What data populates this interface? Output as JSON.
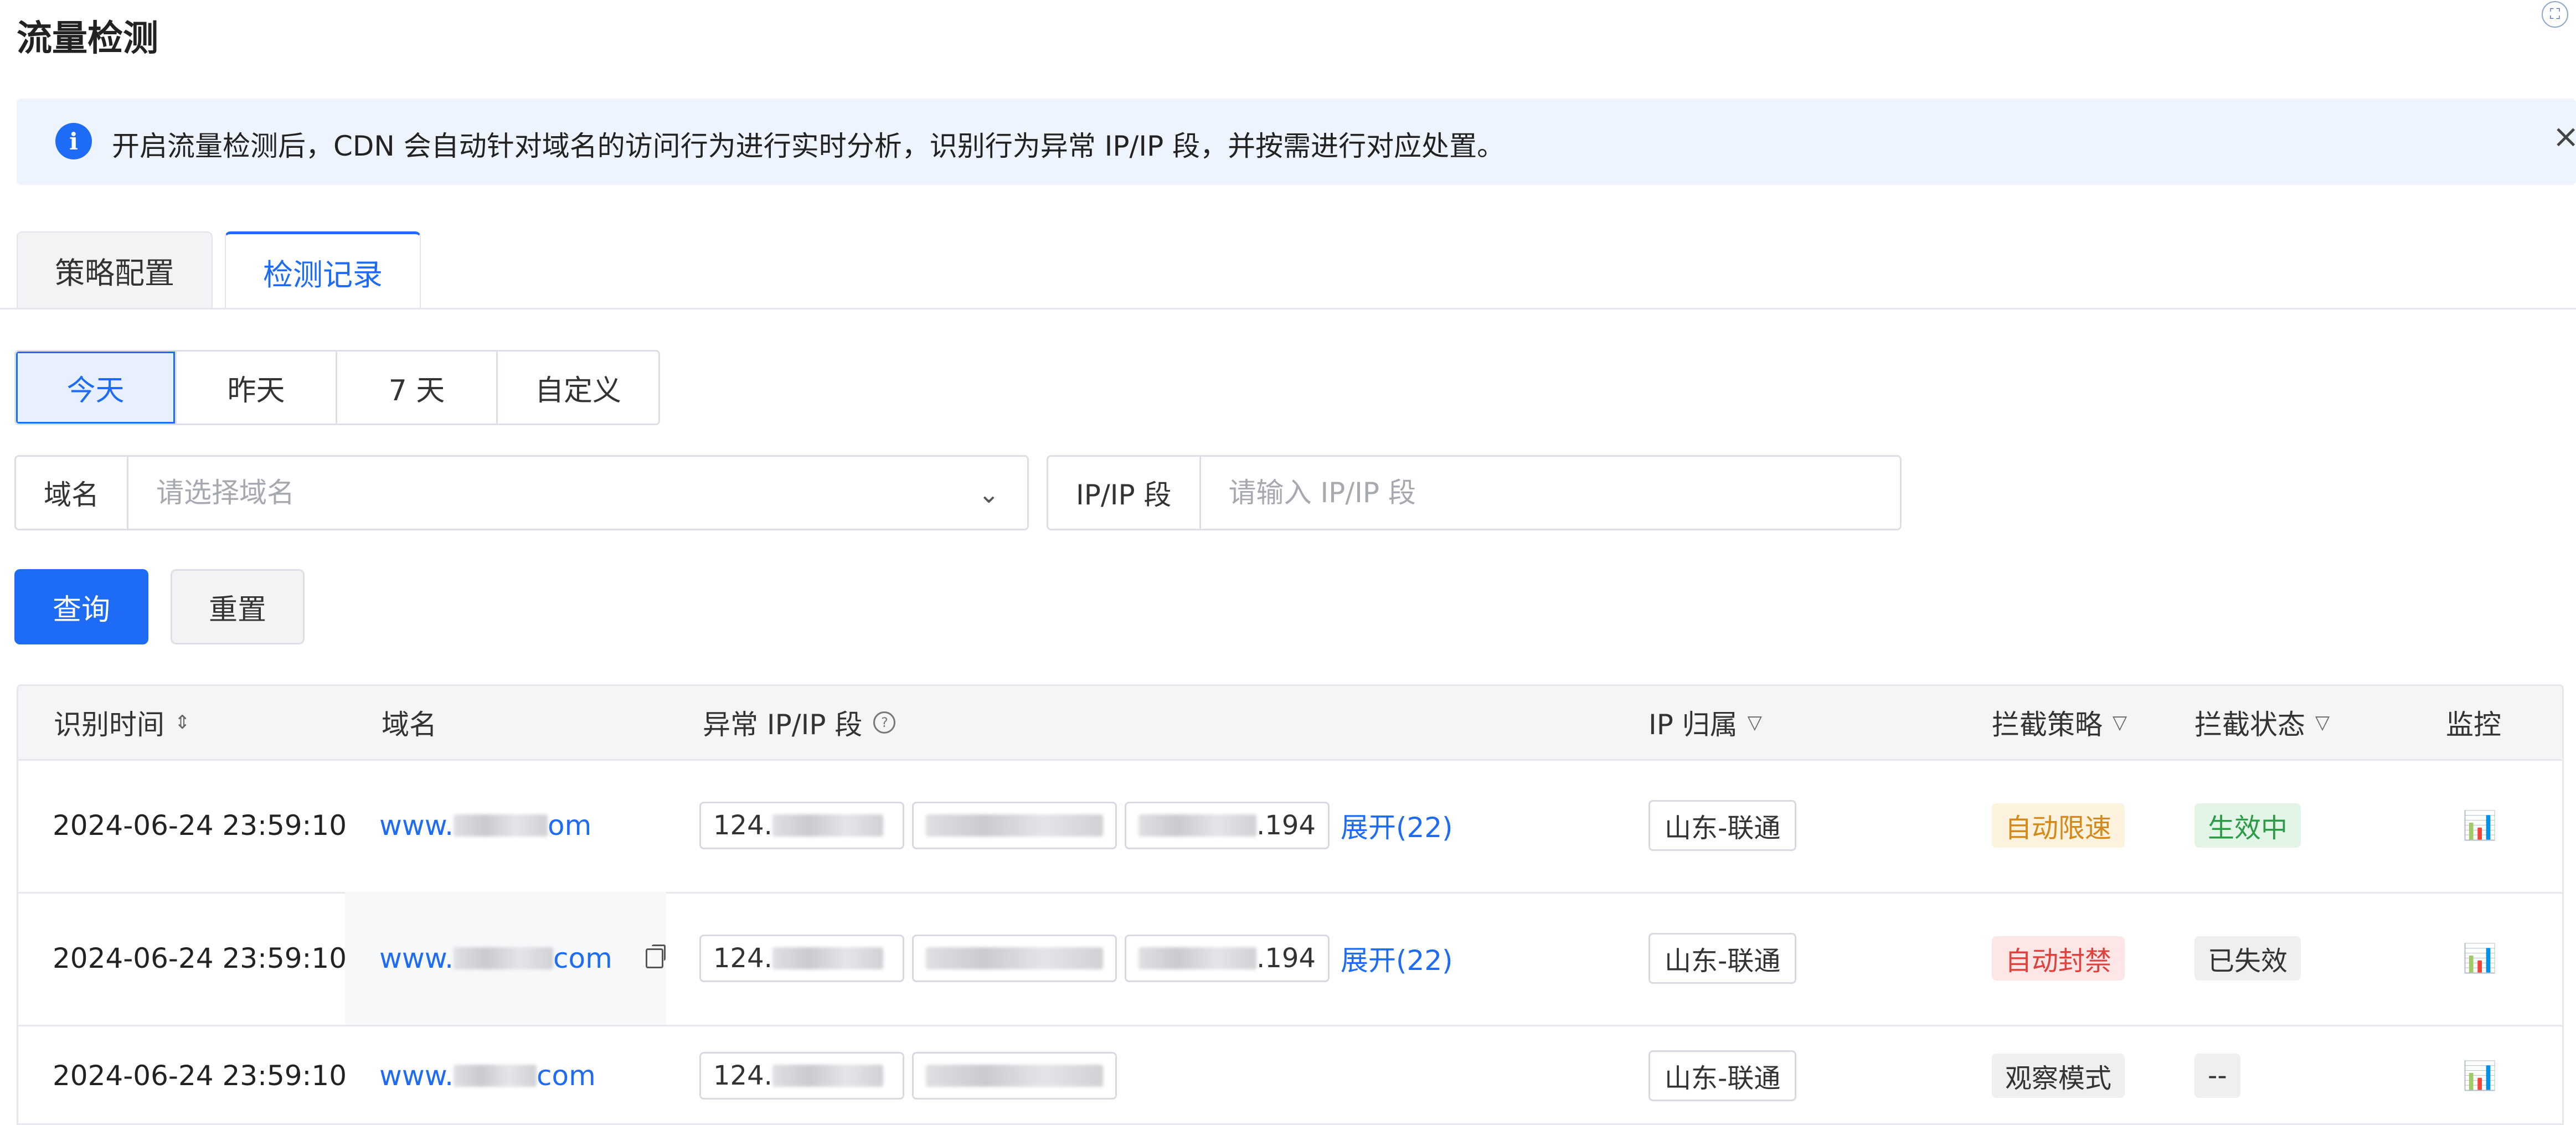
{
  "page": {
    "title": "流量检测"
  },
  "alert": {
    "text": "开启流量检测后，CDN 会自动针对域名的访问行为进行实时分析，识别行为异常 IP/IP 段，并按需进行对应处置。",
    "close_label": "×"
  },
  "tabs": [
    {
      "label": "策略配置",
      "active": false
    },
    {
      "label": "检测记录",
      "active": true
    }
  ],
  "time_range": {
    "options": [
      "今天",
      "昨天",
      "7 天",
      "自定义"
    ],
    "selected": "今天"
  },
  "filters": {
    "domain_label": "域名",
    "domain_placeholder": "请选择域名",
    "domain_value": "",
    "ip_label": "IP/IP 段",
    "ip_placeholder": "请输入 IP/IP 段",
    "ip_value": ""
  },
  "actions": {
    "query_label": "查询",
    "reset_label": "重置"
  },
  "table": {
    "columns": [
      "识别时间",
      "域名",
      "异常 IP/IP 段",
      "IP 归属",
      "拦截策略",
      "拦截状态",
      "监控"
    ],
    "rows": [
      {
        "time": "2024-06-24 23:59:10",
        "domain_prefix": "www.",
        "domain_suffix": "om",
        "ips": [
          {
            "prefix": "124.",
            "suffix": ""
          },
          {
            "prefix": "",
            "suffix": ""
          },
          {
            "prefix": "",
            "suffix": ".194"
          }
        ],
        "expand_label": "展开(22)",
        "location": "山东-联通",
        "policy": "自动限速",
        "status": "生效中"
      },
      {
        "time": "2024-06-24 23:59:10",
        "domain_prefix": "www.",
        "domain_suffix": "com",
        "ips": [
          {
            "prefix": "124.",
            "suffix": ""
          },
          {
            "prefix": "",
            "suffix": ""
          },
          {
            "prefix": "",
            "suffix": ".194"
          }
        ],
        "expand_label": "展开(22)",
        "location": "山东-联通",
        "policy": "自动封禁",
        "status": "已失效"
      },
      {
        "time": "2024-06-24 23:59:10",
        "domain_prefix": "www.",
        "domain_suffix": "com",
        "ips": [
          {
            "prefix": "124.",
            "suffix": ""
          },
          {
            "prefix": "",
            "suffix": ""
          }
        ],
        "expand_label": "",
        "location": "山东-联通",
        "policy": "观察模式",
        "status": "--"
      }
    ]
  },
  "colors": {
    "primary": "#1e6bf5",
    "tag_limit_bg": "#fdf2dd",
    "tag_limit_fg": "#d4891a",
    "tag_block_bg": "#fde6e6",
    "tag_block_fg": "#e0413c",
    "tag_active_bg": "#e3f5e7",
    "tag_active_fg": "#2c9a47",
    "tag_neutral_bg": "#eeeff1",
    "tag_neutral_fg": "#333333"
  },
  "icons": {
    "info": "info-icon",
    "sort": "sort-icon",
    "filter": "filter-icon",
    "help": "help-icon",
    "copy": "copy-icon",
    "monitor": "bar-chart-icon",
    "chevron": "chevron-down-icon"
  }
}
